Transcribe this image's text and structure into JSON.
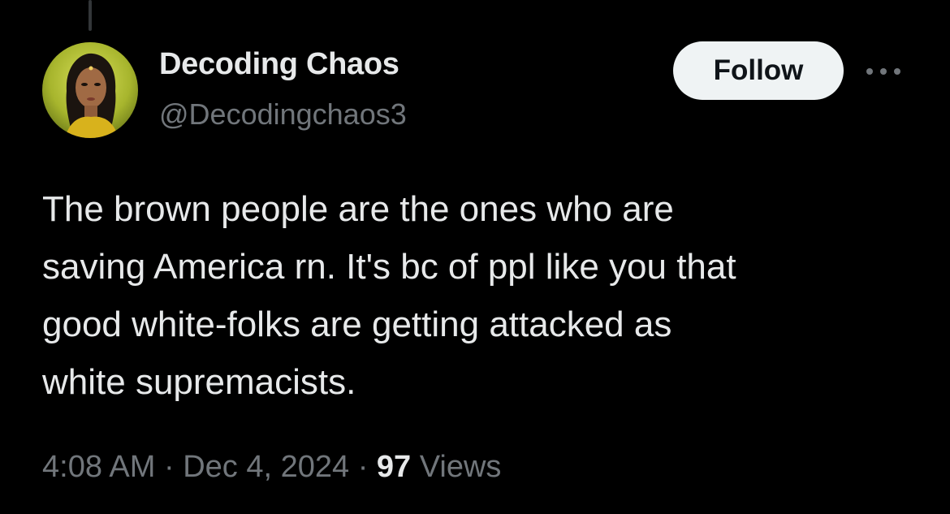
{
  "author": {
    "display_name": "Decoding Chaos",
    "handle": "@Decodingchaos3"
  },
  "actions": {
    "follow_label": "Follow",
    "more_icon": "more-horizontal-icon"
  },
  "tweet": {
    "lines": [
      "The brown people are the ones who are",
      "saving America rn. It's bc of ppl like you that",
      "good white-folks are getting attacked as",
      "white supremacists."
    ]
  },
  "meta": {
    "time": "4:08 AM",
    "separator": "·",
    "date": "Dec 4, 2024",
    "views_count": "97",
    "views_label": "Views"
  },
  "colors": {
    "background": "#000000",
    "primary_text": "#e7e9ea",
    "secondary_text": "#71767b",
    "follow_bg": "#eff3f4",
    "follow_text": "#0f1419"
  }
}
